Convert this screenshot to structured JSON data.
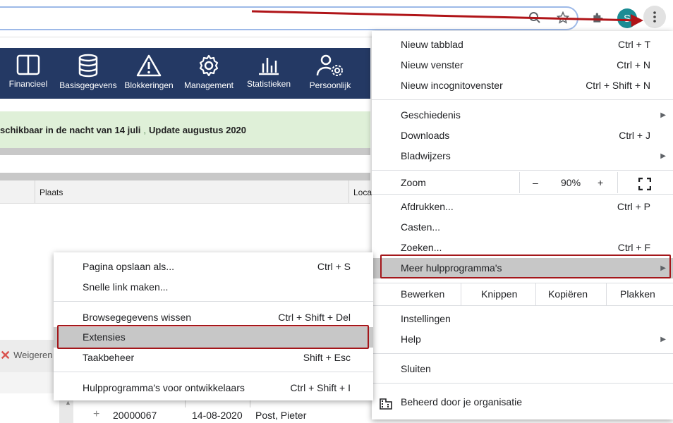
{
  "chrome": {
    "icons": [
      "search-icon",
      "star-icon",
      "extensions-icon",
      "profile-avatar",
      "kebab-menu-icon"
    ],
    "avatar_letter": "S",
    "annotation_color": "#b01418"
  },
  "page": {
    "nav": [
      {
        "label": "Financieel",
        "icon": "book-icon"
      },
      {
        "label": "Basisgegevens",
        "icon": "database-icon"
      },
      {
        "label": "Blokkeringen",
        "icon": "warning-icon"
      },
      {
        "label": "Management",
        "icon": "gear-icon"
      },
      {
        "label": "Statistieken",
        "icon": "bar-chart-icon"
      },
      {
        "label": "Persoonlijk",
        "icon": "user-settings-icon"
      }
    ],
    "banner_text": "schikbaar in de nacht van 14 juli",
    "banner_sep": ",",
    "banner_link": "Update augustus 2020",
    "table_headers": [
      "Plaats",
      "Loca"
    ],
    "refuse_label": "Weigeren",
    "row": {
      "id": "20000067",
      "date": "14-08-2020",
      "name": "Post, Pieter"
    }
  },
  "main_menu": {
    "new_tab": {
      "label": "Nieuw tabblad",
      "shortcut": "Ctrl + T"
    },
    "new_window": {
      "label": "Nieuw venster",
      "shortcut": "Ctrl + N"
    },
    "incognito": {
      "label": "Nieuw incognitovenster",
      "shortcut": "Ctrl + Shift + N"
    },
    "history": {
      "label": "Geschiedenis"
    },
    "downloads": {
      "label": "Downloads",
      "shortcut": "Ctrl + J"
    },
    "bookmarks": {
      "label": "Bladwijzers"
    },
    "zoom": {
      "label": "Zoom",
      "minus": "–",
      "value": "90%",
      "plus": "+"
    },
    "print": {
      "label": "Afdrukken...",
      "shortcut": "Ctrl + P"
    },
    "cast": {
      "label": "Casten..."
    },
    "find": {
      "label": "Zoeken...",
      "shortcut": "Ctrl + F"
    },
    "more_tools": {
      "label": "Meer hulpprogramma's"
    },
    "edit": {
      "label": "Bewerken",
      "cut": "Knippen",
      "copy": "Kopiëren",
      "paste": "Plakken"
    },
    "settings": {
      "label": "Instellingen"
    },
    "help": {
      "label": "Help"
    },
    "exit": {
      "label": "Sluiten"
    },
    "managed": {
      "label": "Beheerd door je organisatie"
    }
  },
  "sub_menu": {
    "save_page": {
      "label": "Pagina opslaan als...",
      "shortcut": "Ctrl + S"
    },
    "create_shortcut": {
      "label": "Snelle link maken..."
    },
    "clear_data": {
      "label": "Browsegegevens wissen",
      "shortcut": "Ctrl + Shift + Del"
    },
    "extensions": {
      "label": "Extensies"
    },
    "task_manager": {
      "label": "Taakbeheer",
      "shortcut": "Shift + Esc"
    },
    "dev_tools": {
      "label": "Hulpprogramma's voor ontwikkelaars",
      "shortcut": "Ctrl + Shift + I"
    }
  }
}
